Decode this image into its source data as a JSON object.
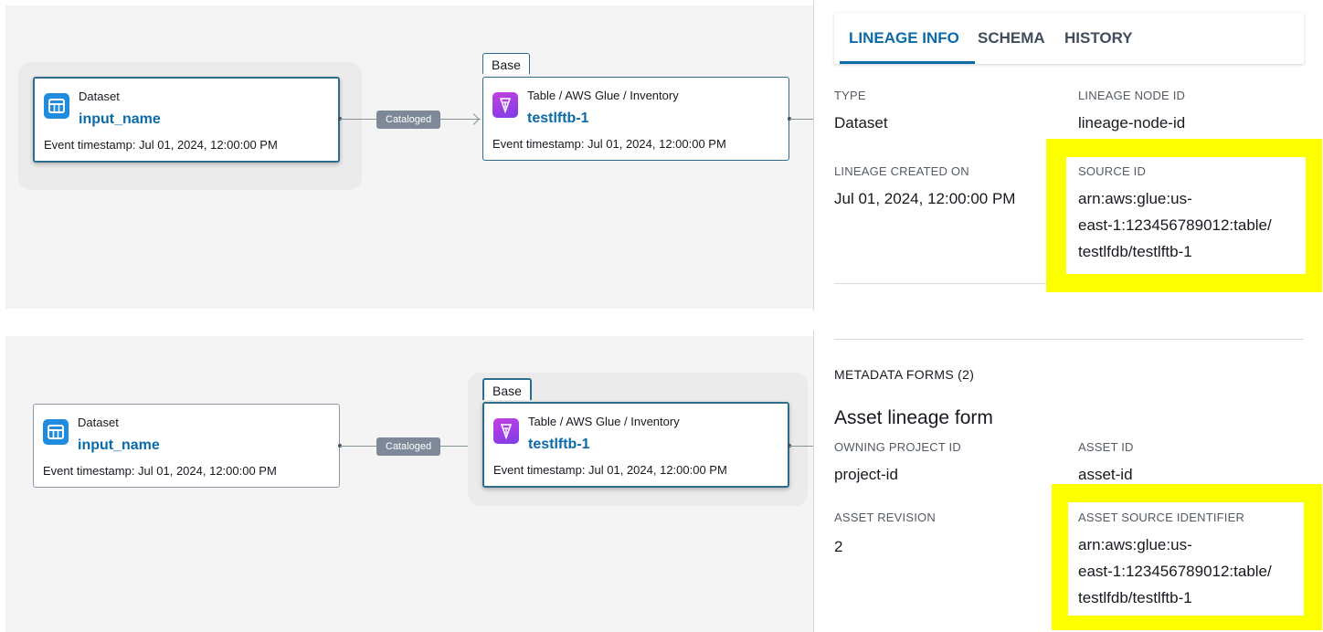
{
  "graph": {
    "source_node": {
      "type": "Dataset",
      "name": "input_name",
      "event_timestamp": "Event timestamp: Jul 01, 2024, 12:00:00 PM",
      "icon": "table-icon"
    },
    "target_node": {
      "badge": "Base",
      "type": "Table / AWS Glue / Inventory",
      "name": "testlftb-1",
      "event_timestamp": "Event timestamp: Jul 01, 2024, 12:00:00 PM",
      "icon": "aws-glue-icon"
    },
    "edge_label": "Cataloged"
  },
  "tabs": [
    {
      "label": "LINEAGE INFO",
      "active": true
    },
    {
      "label": "SCHEMA",
      "active": false
    },
    {
      "label": "HISTORY",
      "active": false
    }
  ],
  "lineage_info": {
    "type_key": "TYPE",
    "type_value": "Dataset",
    "node_id_key": "LINEAGE NODE ID",
    "node_id_value": "lineage-node-id",
    "created_key": "LINEAGE CREATED ON",
    "created_value": "Jul 01, 2024, 12:00:00 PM",
    "source_id_key": "SOURCE ID",
    "source_id_lines": [
      "arn:aws:glue:us-",
      "east-1:123456789012:table/",
      "testlfdb/testlftb-1"
    ]
  },
  "metadata": {
    "section_title": "METADATA FORMS (2)",
    "form_title": "Asset lineage form",
    "owning_project_key": "OWNING PROJECT ID",
    "owning_project_value": "project-id",
    "asset_id_key": "ASSET ID",
    "asset_id_value": "asset-id",
    "asset_revision_key": "ASSET REVISION",
    "asset_revision_value": "2",
    "asset_source_key": "ASSET SOURCE IDENTIFIER",
    "asset_source_lines": [
      "arn:aws:glue:us-",
      "east-1:123456789012:table/",
      "testlfdb/testlftb-1"
    ]
  },
  "colors": {
    "highlight": "#fcff00",
    "link": "#0b6aa8",
    "accent": "#2e6c8e"
  }
}
